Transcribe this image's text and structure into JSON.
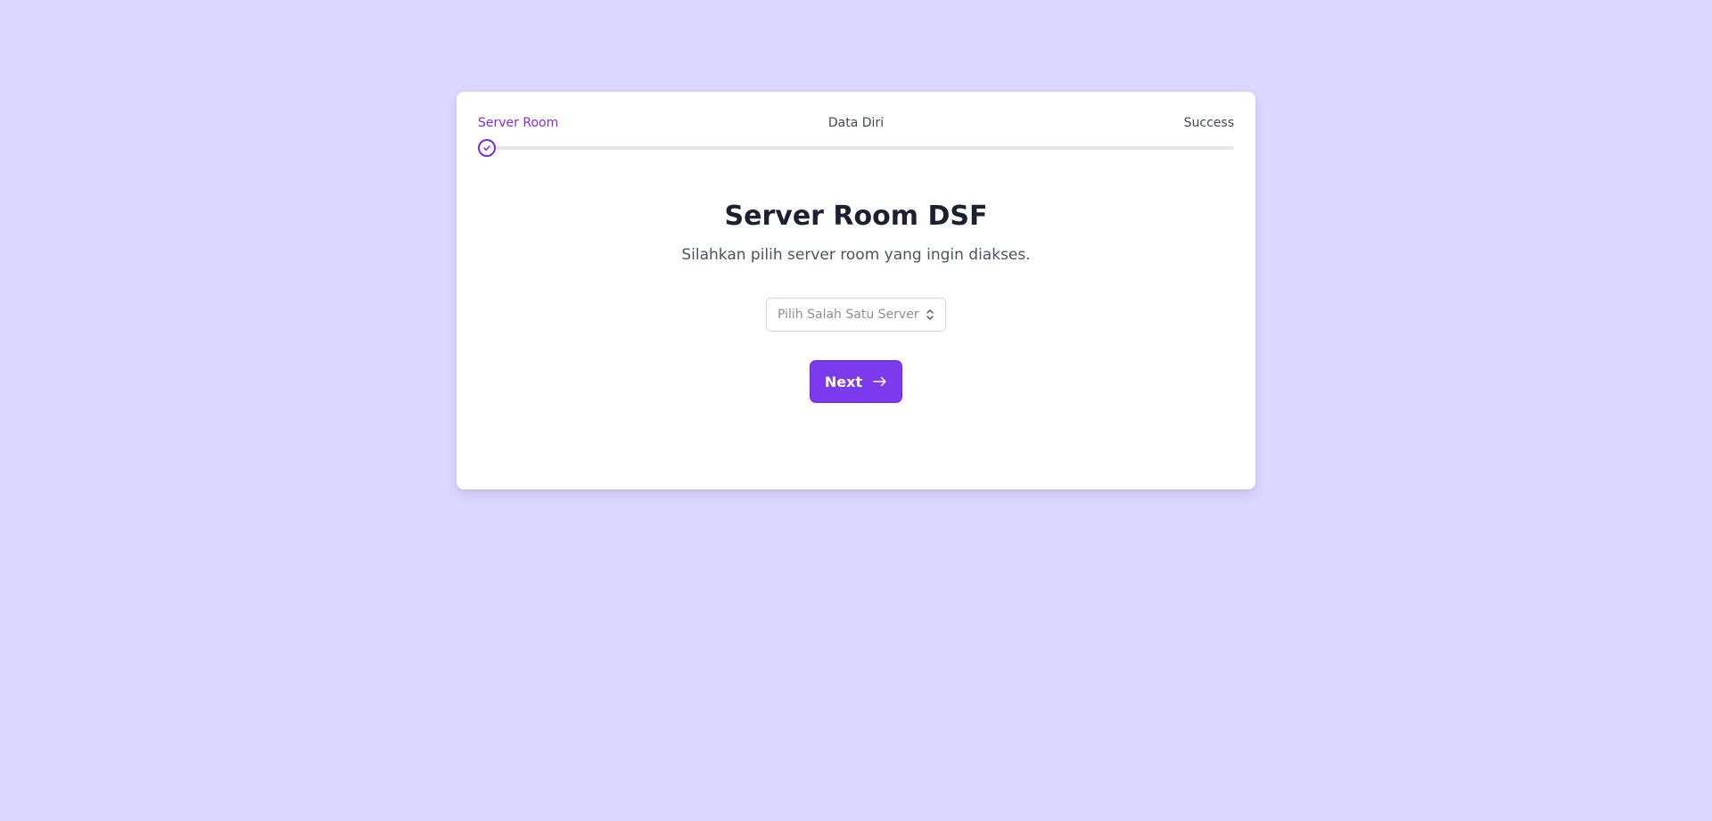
{
  "stepper": {
    "steps": [
      {
        "label": "Server Room",
        "state": "active"
      },
      {
        "label": "Data Diri",
        "state": "pending"
      },
      {
        "label": "Success",
        "state": "pending"
      }
    ],
    "progress_fraction": 0
  },
  "main": {
    "title": "Server Room DSF",
    "subtitle": "Silahkan pilih server room yang ingin diakses.",
    "server_select": {
      "placeholder": "Pilih Salah Satu Server",
      "icon": "chevron-up-down-icon"
    },
    "next_button": {
      "label": "Next",
      "icon": "arrow-right-icon"
    }
  },
  "colors": {
    "page_background": "#dcd7fe",
    "accent": "#7c3aed",
    "active_step": "#7c2ae6"
  }
}
